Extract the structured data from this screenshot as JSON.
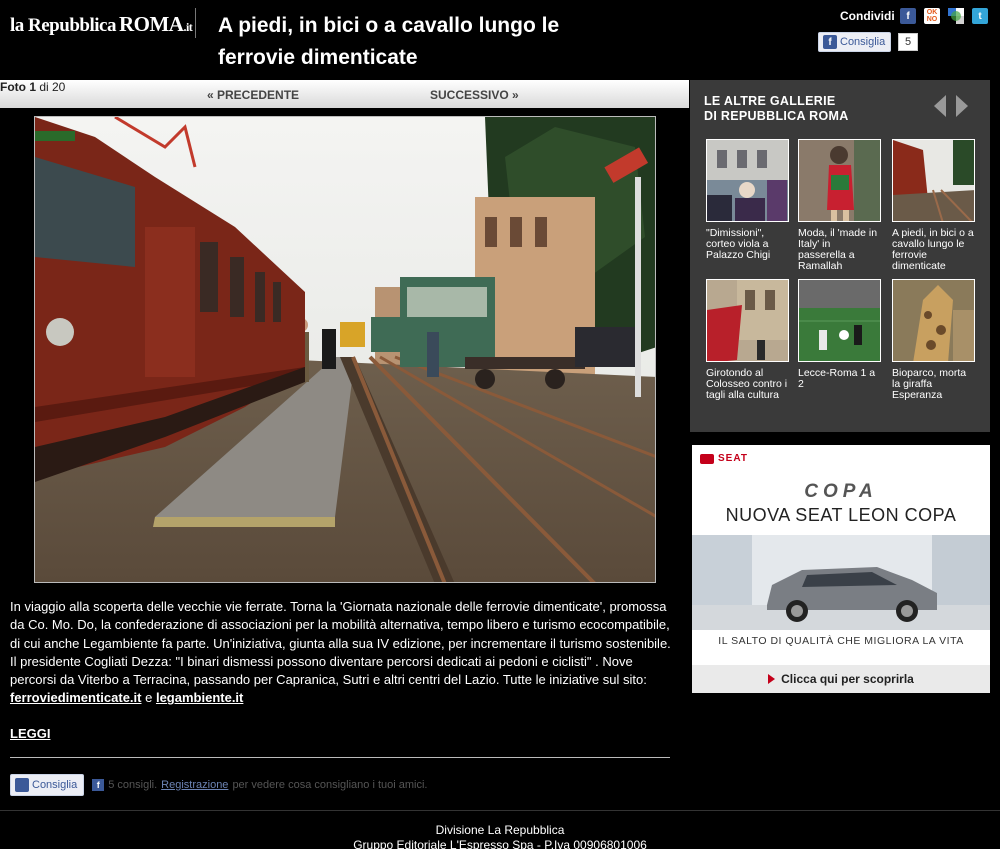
{
  "header": {
    "logo_main": "la Repubblica",
    "logo_roma": "ROMA",
    "logo_suffix": ".it",
    "title": "A piedi, in bici o a cavallo lungo le ferrovie dimenticate",
    "share_label": "Condividi",
    "share_icons": [
      "facebook-icon",
      "oknotizie-icon",
      "delicious-icon",
      "twitter-icon"
    ],
    "like_label": "Consiglia",
    "like_count": "5"
  },
  "nav": {
    "prev": "« PRECEDENTE",
    "photo_word": "Foto 1",
    "photo_of": " di 20",
    "next": "SUCCESSIVO »"
  },
  "caption": {
    "text": "In viaggio alla scoperta delle vecchie vie ferrate. Torna la 'Giornata nazionale delle ferrovie dimenticate', promossa da Co. Mo. Do, la confederazione di associazioni per la mobilità alternativa, tempo libero e turismo ecocompatibile, di cui anche Legambiente fa parte. Un'iniziativa, giunta alla sua IV edizione, per incrementare il turismo sostenibile. Il presidente Cogliati Dezza: \"I binari dismessi possono diventare percorsi dedicati ai pedoni e ciclisti\" . Nove percorsi da Viterbo a Terracina, passando per Capranica, Sutri e altri centri del Lazio. Tutte le iniziative sul sito: ",
    "link1": "ferroviedimenticate.it",
    "and": " e ",
    "link2": "legambiente.it"
  },
  "leggi": "LEGGI",
  "facebook_bar": {
    "button": "Consiglia",
    "count_text": "5 consigli.",
    "register": "Registrazione",
    "rest": "per vedere cosa consigliano i tuoi amici."
  },
  "footer": {
    "line1": "Divisione La Repubblica",
    "line2": "Gruppo Editoriale L'Espresso Spa - P.Iva 00906801006"
  },
  "sidebar": {
    "title_line1": "LE ALTRE GALLERIE",
    "title_line2": "DI REPUBBLICA ROMA",
    "items": [
      {
        "caption": "\"Dimissioni\", corteo viola a Palazzo Chigi"
      },
      {
        "caption": "Moda, il 'made in Italy' in passerella a Ramallah"
      },
      {
        "caption": "A piedi, in bici o a cavallo lungo le ferrovie dimenticate"
      },
      {
        "caption": "Girotondo al Colosseo contro i tagli alla cultura"
      },
      {
        "caption": "Lecce-Roma 1 a 2"
      },
      {
        "caption": "Bioparco, morta la giraffa Esperanza"
      }
    ]
  },
  "ad": {
    "brand": "SEAT",
    "copa": "COPA",
    "headline": "NUOVA SEAT LEON COPA",
    "tagline": "IL SALTO DI QUALITÀ CHE MIGLIORA LA VITA",
    "cta": "Clicca qui per scoprirla"
  }
}
